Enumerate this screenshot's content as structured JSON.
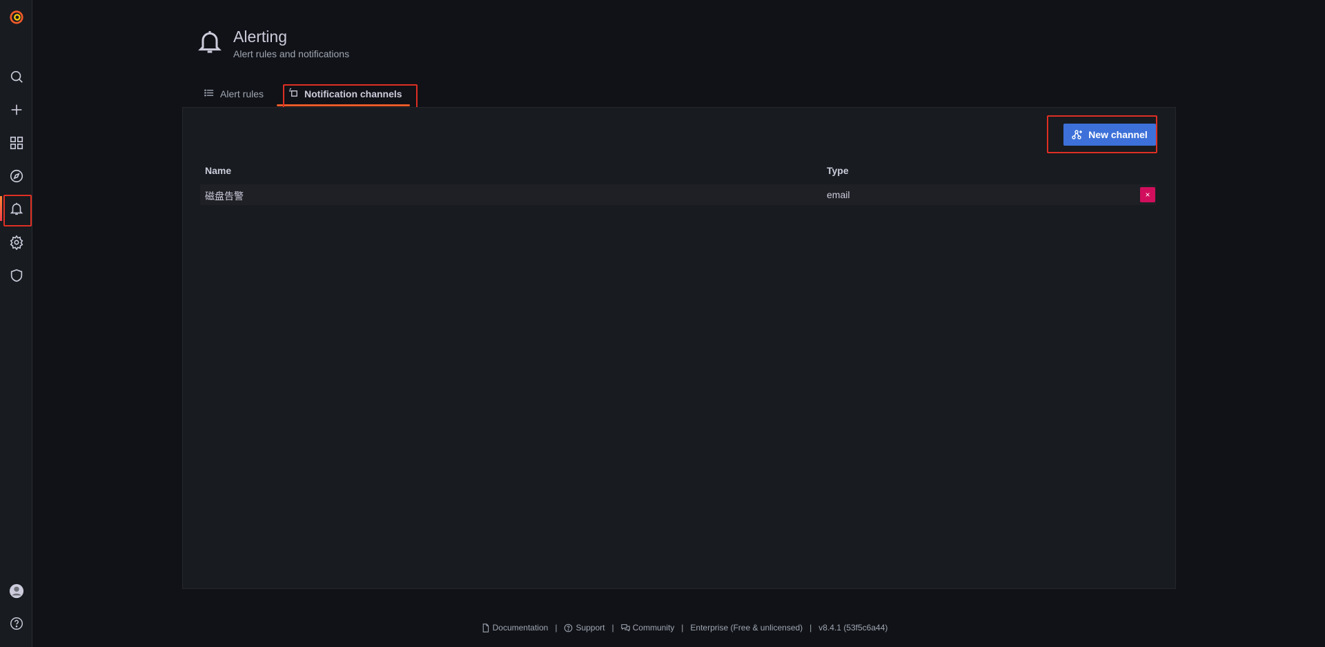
{
  "header": {
    "title": "Alerting",
    "subtitle": "Alert rules and notifications",
    "icon": "bell-icon"
  },
  "tabs": [
    {
      "label": "Alert rules",
      "icon": "list-icon",
      "active": false
    },
    {
      "label": "Notification channels",
      "icon": "channels-icon",
      "active": true
    }
  ],
  "panel": {
    "new_button_label": "New channel",
    "columns": {
      "name": "Name",
      "type": "Type"
    },
    "rows": [
      {
        "name": "磁盘告警",
        "type": "email",
        "delete_label": "×"
      }
    ]
  },
  "sidebar": {
    "items": [
      "grafana-logo-icon",
      "search-icon",
      "plus-icon",
      "dashboards-icon",
      "explore-icon",
      "bell-icon",
      "gear-icon",
      "shield-icon",
      "avatar-icon",
      "help-icon"
    ],
    "active": "bell-icon"
  },
  "footer": {
    "documentation": "Documentation",
    "support": "Support",
    "community": "Community",
    "edition": "Enterprise (Free & unlicensed)",
    "version": "v8.4.1 (53f5c6a44)",
    "separator": "|"
  },
  "colors": {
    "accent": "#3d71d9",
    "danger": "#d10e5c",
    "tab_underline": "#e85a29",
    "highlight": "#e02f24"
  }
}
